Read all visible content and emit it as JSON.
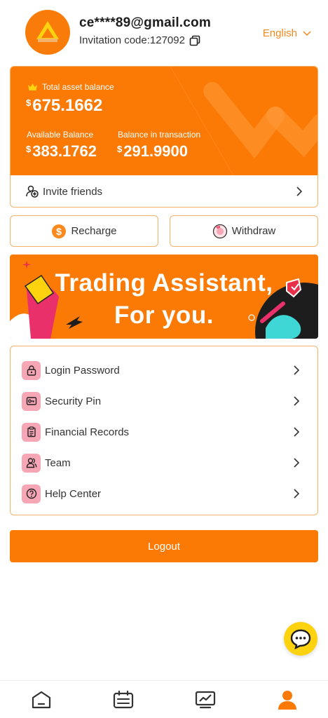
{
  "user": {
    "email": "ce****89@gmail.com",
    "invitation_code": "Invitation code:127092"
  },
  "language": {
    "selected": "English"
  },
  "balance": {
    "currency_symbol": "$",
    "total_label": "Total asset balance",
    "total_value": "675.1662",
    "available_label": "Available Balance",
    "available_value": "383.1762",
    "transaction_label": "Balance in transaction",
    "transaction_value": "291.9900",
    "invite_label": "Invite friends"
  },
  "actions": {
    "recharge_label": "Recharge",
    "withdraw_label": "Withdraw"
  },
  "banner": {
    "line1": "Trading Assistant,",
    "line2": "For you."
  },
  "menu": {
    "items": [
      {
        "label": "Login Password",
        "icon": "lock-icon"
      },
      {
        "label": "Security Pin",
        "icon": "key-icon"
      },
      {
        "label": "Financial Records",
        "icon": "clipboard-icon"
      },
      {
        "label": "Team",
        "icon": "people-icon"
      },
      {
        "label": "Help Center",
        "icon": "question-icon"
      }
    ]
  },
  "logout_label": "Logout",
  "bottom_nav": {
    "items": [
      {
        "icon": "home-icon",
        "active": false
      },
      {
        "icon": "orders-icon",
        "active": false
      },
      {
        "icon": "market-chart-icon",
        "active": false
      },
      {
        "icon": "profile-icon",
        "active": true
      }
    ]
  },
  "colors": {
    "accent": "#fb7a06",
    "border": "#f4b36c",
    "menu_icon_bg": "#f7a6b5",
    "chat_bg": "#fdd20e",
    "inactive_icon": "#333333"
  }
}
